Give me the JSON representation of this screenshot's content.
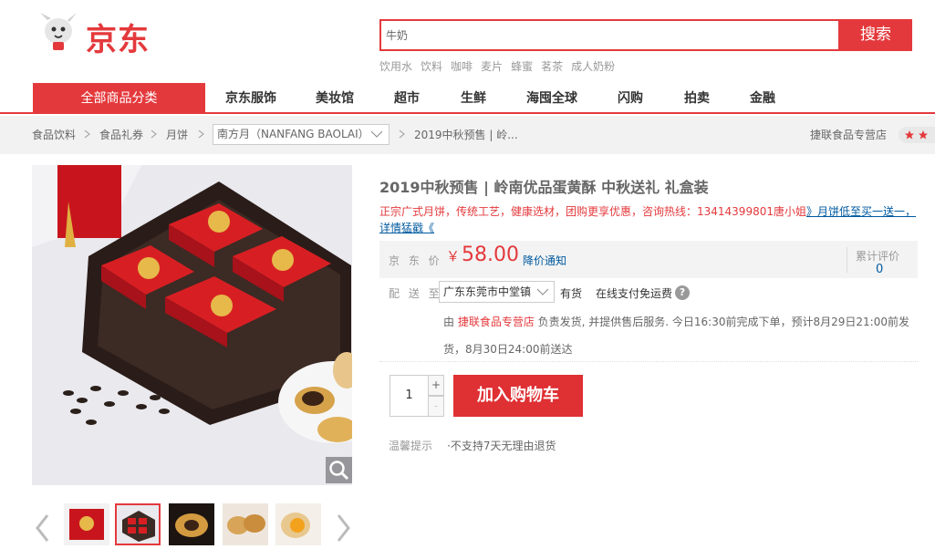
{
  "header": {
    "logo_text": "京东",
    "search_value": "牛奶",
    "search_button": "搜索",
    "hotwords": [
      "饮用水",
      "饮料",
      "咖啡",
      "麦片",
      "蜂蜜",
      "茗茶",
      "成人奶粉"
    ]
  },
  "nav": {
    "all_categories": "全部商品分类",
    "items": [
      "京东服饰",
      "美妆馆",
      "超市",
      "生鲜",
      "海囤全球",
      "闪购",
      "拍卖",
      "金融"
    ]
  },
  "breadcrumb": {
    "items": [
      "食品饮料",
      "食品礼券",
      "月饼"
    ],
    "brand_select": "南方月（NANFANG BAOLAI）",
    "product": "2019中秋预售 | 岭...",
    "store": "捷联食品专营店"
  },
  "product": {
    "title": "2019中秋预售 | 岭南优品蛋黄酥 中秋送礼 礼盒装",
    "promo_text": "正宗广式月饼，传统工艺，健康选材，团购更享优惠，咨询热线：13414399801唐小姐",
    "promo_link": "》月饼低至买一送一，详情猛戳《",
    "price_label": "京 东 价",
    "currency": "￥",
    "price": "58.00",
    "price_notice": "降价通知",
    "review_label": "累计评价",
    "review_count": "0",
    "ship_label": "配 送 至",
    "address": "广东东莞市中堂镇",
    "stock": "有货",
    "free_shipping": "在线支付免运费",
    "service_prefix": "由 ",
    "service_shop": "捷联食品专营店",
    "service_text": " 负责发货, 并提供售后服务. 今日16:30前完成下单，预计8月29日21:00前发货，8月30日24:00前送达",
    "quantity": "1",
    "qty_up": "+",
    "qty_down": "-",
    "cart_button": "加入购物车",
    "tips_label": "温馨提示",
    "tips_text": "·不支持7天无理由退货"
  },
  "colors": {
    "brand_red": "#e4393c",
    "link_blue": "#005aa0"
  },
  "icons": [
    "jd-dog-logo-icon",
    "chevron-down-icon",
    "chevron-right-icon",
    "question-mark-icon",
    "zoom-icon",
    "arrow-left-icon",
    "arrow-right-icon",
    "star-icon"
  ]
}
